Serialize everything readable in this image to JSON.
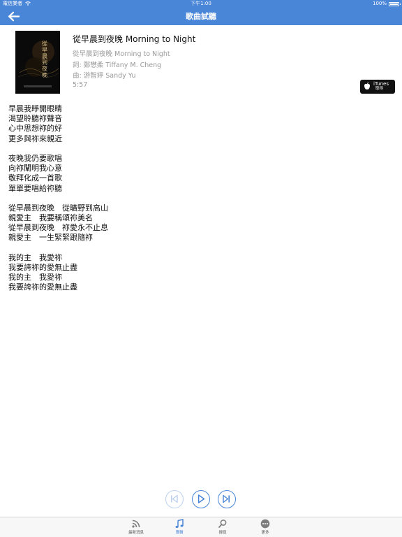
{
  "status_bar": {
    "carrier": "電信業者",
    "time": "下午1:00",
    "battery": "100%"
  },
  "nav": {
    "title": "歌曲試聽",
    "back_icon": "back-arrow-icon"
  },
  "song": {
    "title": "從早晨到夜晚 Morning to Night",
    "album": "從早晨到夜晚 Morning to Night",
    "lyricist": "詞: 鄭懋柔 Tiffany M. Cheng",
    "composer": "曲: 游智婷 Sandy Yu",
    "duration": "5:57",
    "cover_title": "從早晨到夜晚"
  },
  "itunes": {
    "line1": "iTunes",
    "line2": "取得"
  },
  "lyrics": [
    "早晨我睜開眼睛",
    "渴望聆聽祢聲音",
    "心中思想祢的好",
    "更多與祢來親近",
    "",
    "夜晚我仍要歌唱",
    "向祢闡明我心意",
    "敬拜化成一首歌",
    "單單要唱給祢聽",
    "",
    "從早晨到夜晚　從曠野到高山",
    "親愛主　我要稱頌祢美名",
    "從早晨到夜晚　祢愛永不止息",
    "親愛主　一生緊緊跟隨祢",
    "",
    "我的主　我愛祢",
    "我要誇祢的愛無止盡",
    "我的主　我愛祢",
    "我要誇祢的愛無止盡"
  ],
  "controls": {
    "prev_icon": "skip-previous-icon",
    "play_icon": "play-icon",
    "next_icon": "skip-next-icon"
  },
  "tabs": [
    {
      "label": "最新消息",
      "icon": "rss-feed-icon"
    },
    {
      "label": "專輯",
      "icon": "music-note-icon"
    },
    {
      "label": "搜尋",
      "icon": "search-icon"
    },
    {
      "label": "更多",
      "icon": "more-icon"
    }
  ],
  "colors": {
    "accent": "#4a86d8",
    "meta_text": "#9a9a9a",
    "itunes_bg": "#111111",
    "tab_bar_bg": "#f7f7f7"
  }
}
